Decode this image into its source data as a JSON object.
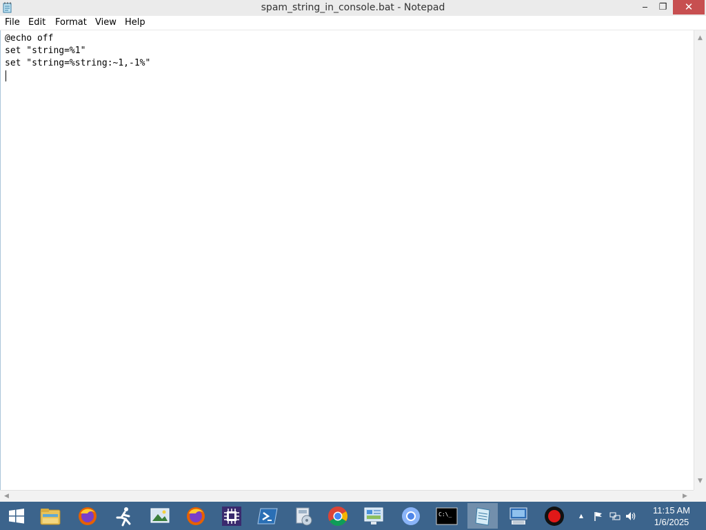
{
  "window": {
    "title": "spam_string_in_console.bat - Notepad",
    "controls": {
      "minimize": "‒",
      "maximize": "❐",
      "close": "✕"
    }
  },
  "menu": {
    "items": [
      "File",
      "Edit",
      "Format",
      "View",
      "Help"
    ]
  },
  "editor": {
    "text": "@echo off\nset \"string=%1\"\nset \"string=%string:~1,-1%\""
  },
  "taskbar": {
    "buttons": [
      {
        "name": "start-button",
        "icon": "windows-logo-icon"
      },
      {
        "name": "file-explorer",
        "icon": "folder-icon"
      },
      {
        "name": "firefox",
        "icon": "firefox-icon"
      },
      {
        "name": "runner-app",
        "icon": "running-man-icon"
      },
      {
        "name": "image-viewer",
        "icon": "picture-icon"
      },
      {
        "name": "firefox-2",
        "icon": "firefox-icon"
      },
      {
        "name": "cpu-app",
        "icon": "chip-icon"
      },
      {
        "name": "powershell",
        "icon": "powershell-icon"
      },
      {
        "name": "disk-app",
        "icon": "disk-icon"
      },
      {
        "name": "chrome",
        "icon": "chrome-icon"
      },
      {
        "name": "control-panel",
        "icon": "control-panel-icon"
      },
      {
        "name": "chromium",
        "icon": "chromium-icon"
      },
      {
        "name": "cmd",
        "icon": "command-prompt-icon",
        "label": "C:\\_"
      },
      {
        "name": "notepad",
        "icon": "notepad-icon",
        "active": true
      },
      {
        "name": "remote-desktop",
        "icon": "remote-desktop-icon"
      },
      {
        "name": "recorder",
        "icon": "record-icon"
      }
    ],
    "tray": {
      "time": "11:15 AM",
      "date": "1/6/2025",
      "icons": [
        "show-hidden-icons-icon",
        "flag-icon",
        "network-icon",
        "volume-icon"
      ],
      "glyphs": {
        "chevron": "▲"
      }
    },
    "colors": {
      "background": "#3c648c",
      "active": "#6b8aaa"
    }
  }
}
